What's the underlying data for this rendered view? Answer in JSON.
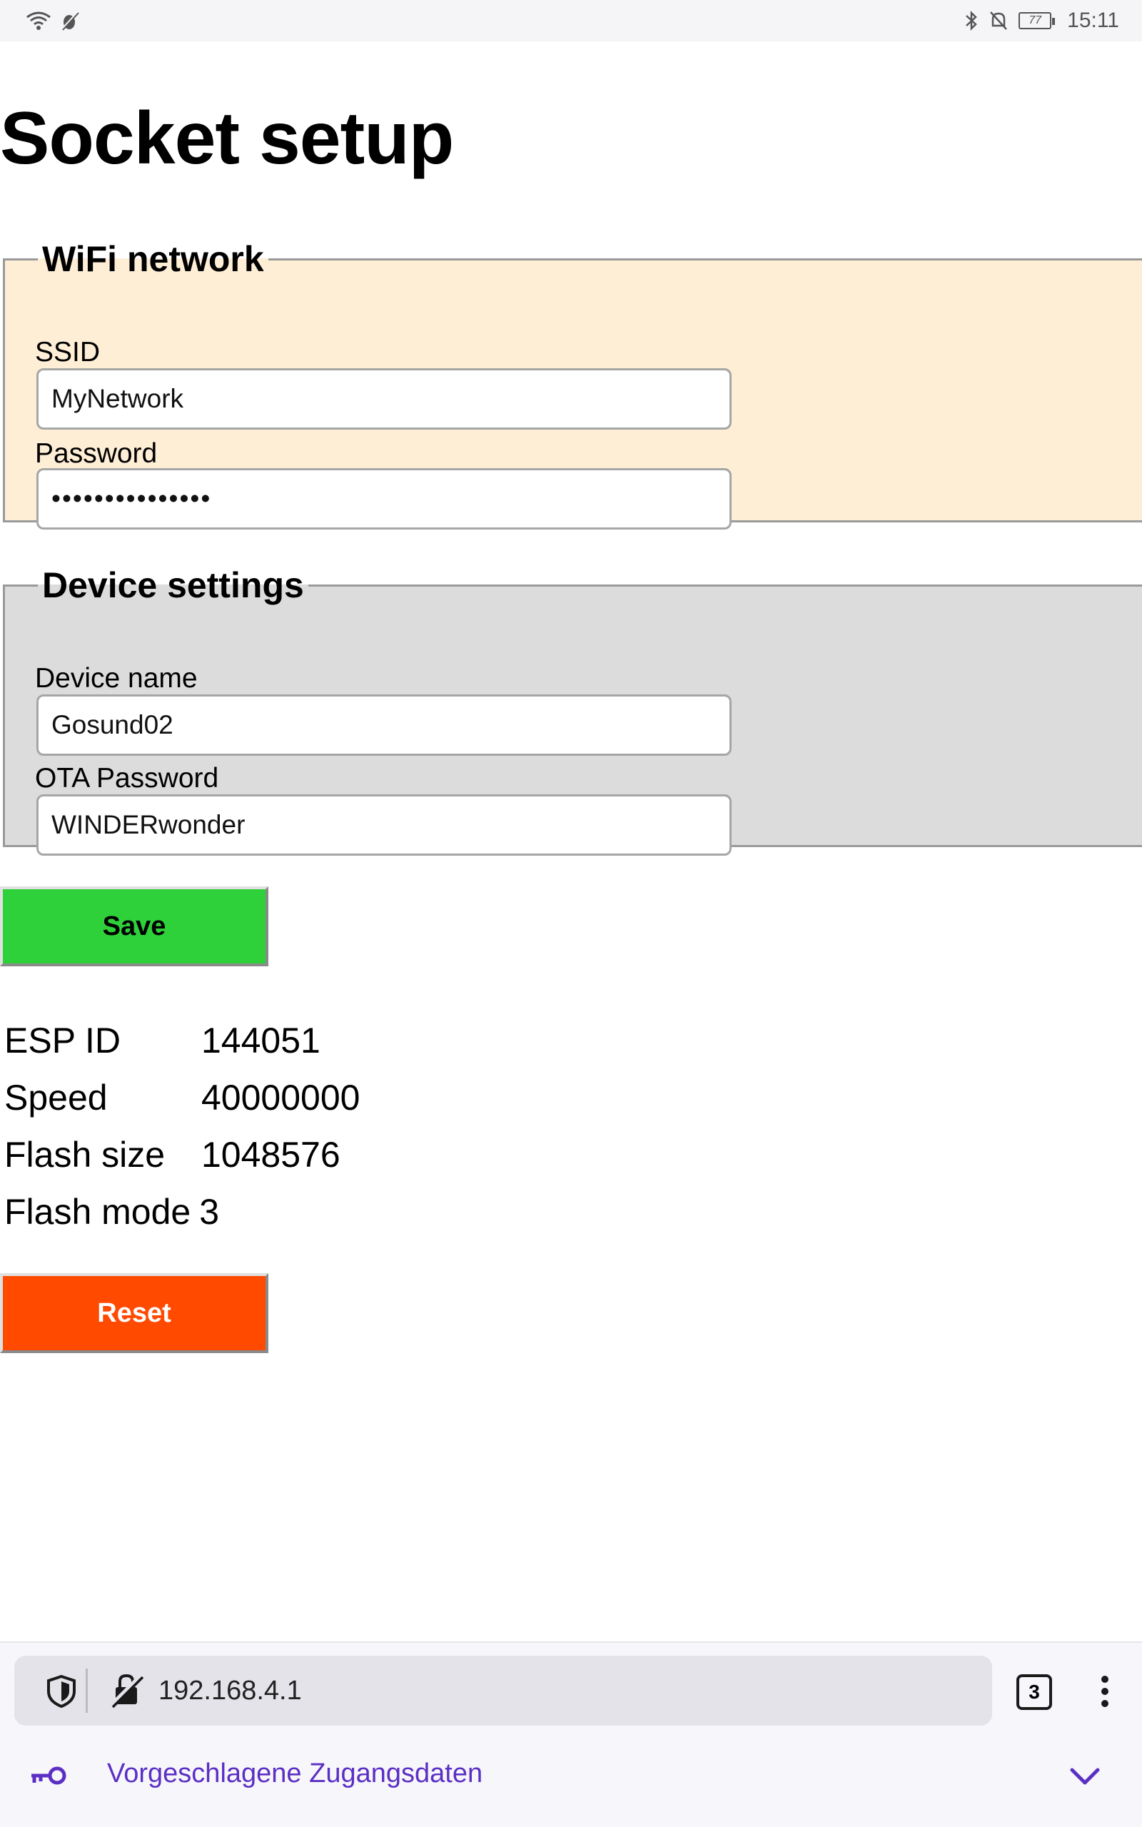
{
  "status_bar": {
    "battery": "77",
    "time": "15:11",
    "icons": [
      "wifi-icon",
      "usb-debug-icon",
      "bluetooth-icon",
      "notifications-off-icon",
      "battery-icon"
    ]
  },
  "page": {
    "title": "Socket setup"
  },
  "wifi_group": {
    "legend": "WiFi network",
    "ssid_label": "SSID",
    "ssid_value": "MyNetwork",
    "password_label": "Password",
    "password_value": "•••••••••••••••"
  },
  "device_group": {
    "legend": "Device settings",
    "name_label": "Device name",
    "name_value": "Gosund02",
    "ota_label": "OTA Password",
    "ota_value": "WINDERwonder"
  },
  "buttons": {
    "save": "Save",
    "reset": "Reset"
  },
  "info": [
    {
      "key": "ESP ID",
      "value": "144051"
    },
    {
      "key": "Speed",
      "value": "40000000"
    },
    {
      "key": "Flash size",
      "value": "1048576"
    },
    {
      "key": "Flash mode",
      "value": "3"
    }
  ],
  "browser": {
    "url": "192.168.4.1",
    "tab_count": "3",
    "suggested_credentials": "Vorgeschlagene Zugangsdaten"
  },
  "colors": {
    "wifi_bg": "#ffeed6",
    "device_bg": "#dcdcdc",
    "save_bg": "#2fd13a",
    "reset_bg": "#ff4a00",
    "accent_purple": "#5b2fc4"
  }
}
